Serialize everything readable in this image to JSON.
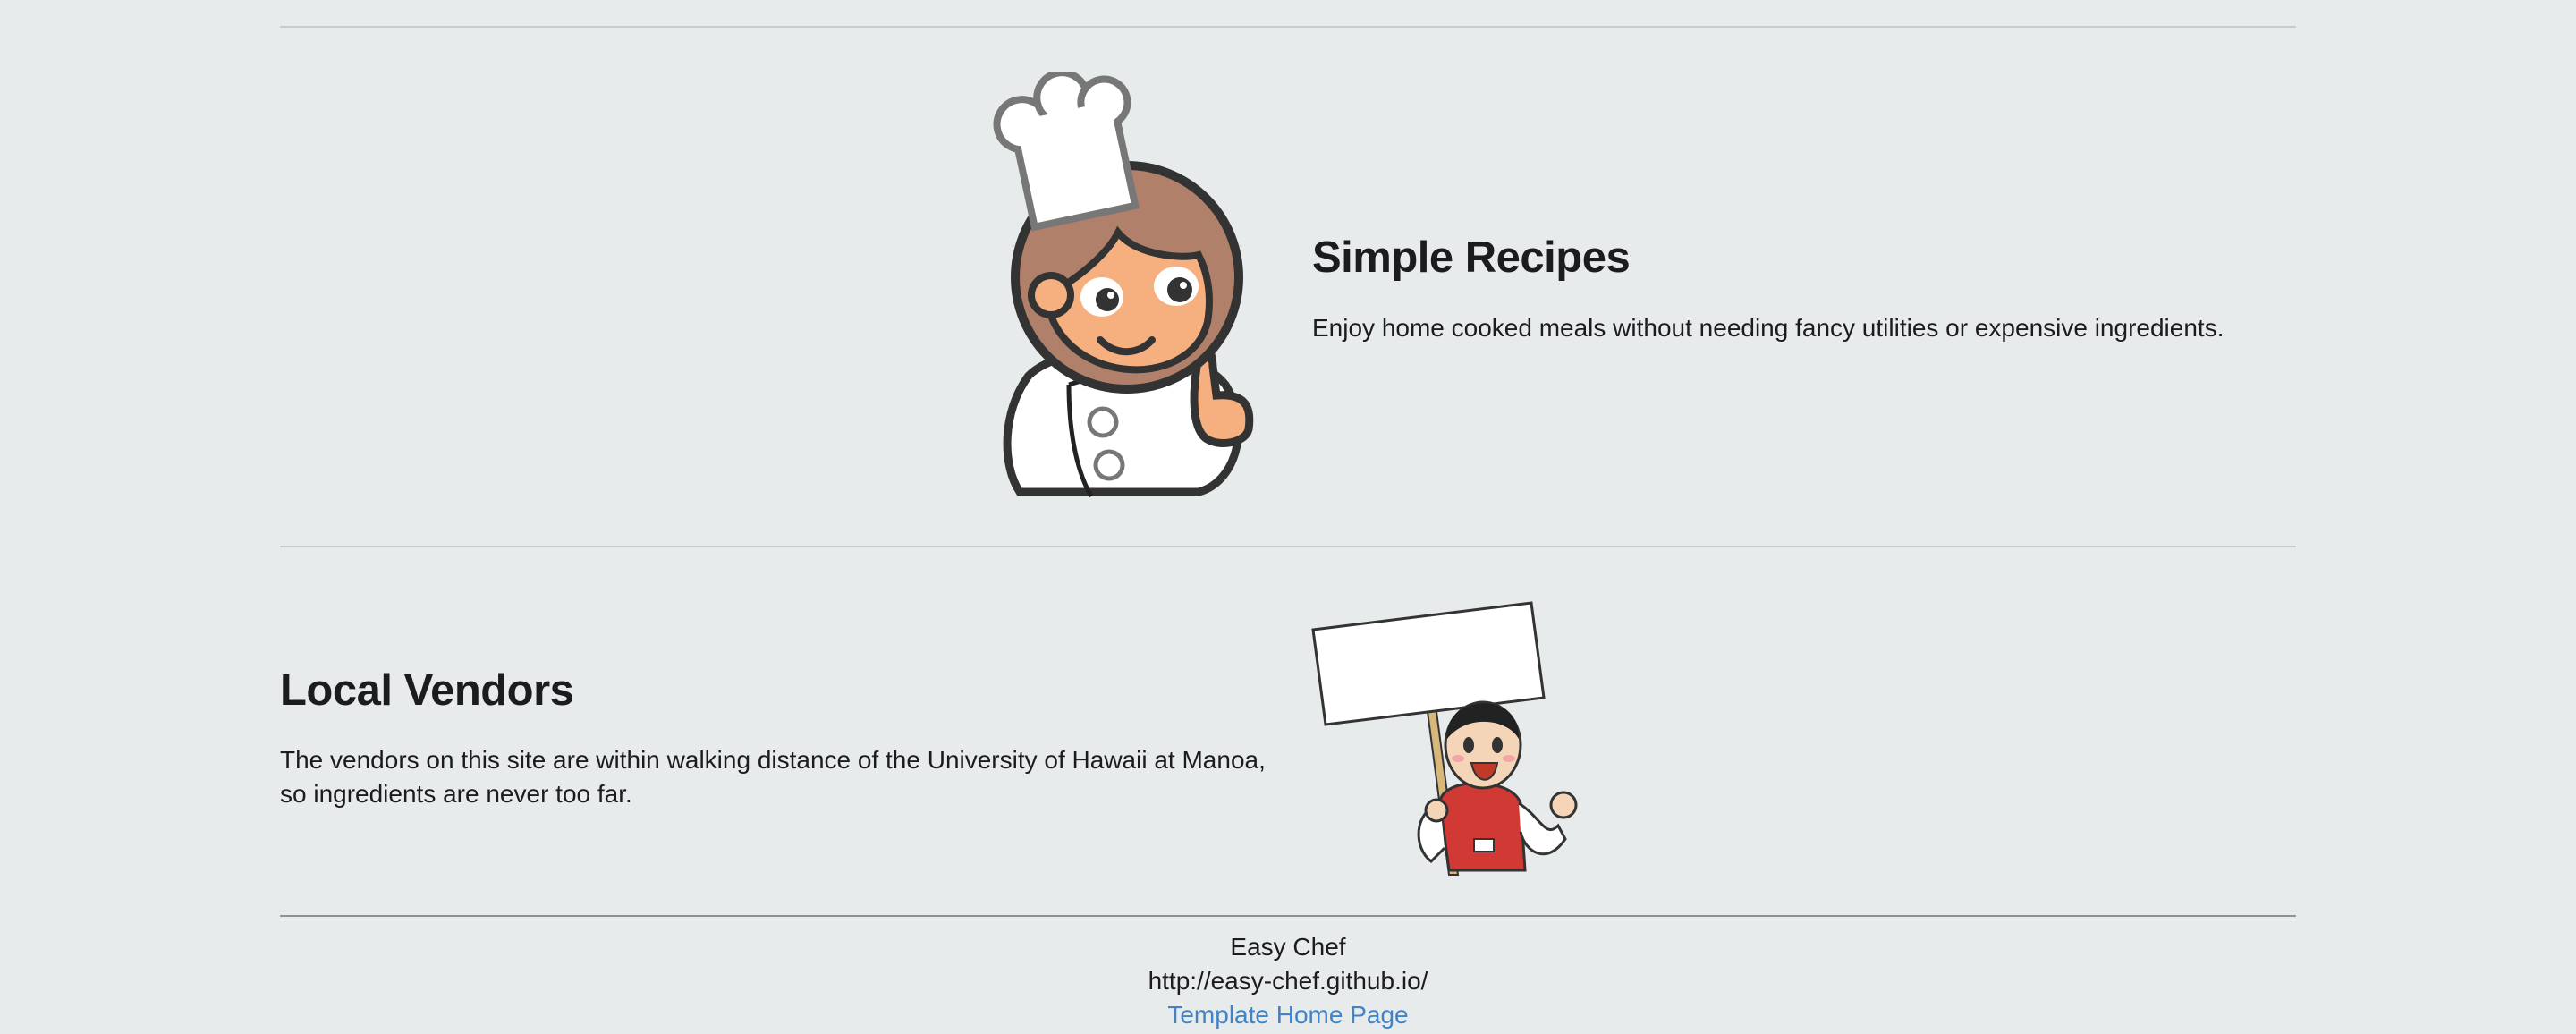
{
  "features": [
    {
      "title": "Simple Recipes",
      "description": "Enjoy home cooked meals without needing fancy utilities or expensive ingredients.",
      "image": "chef-thumbs-up-illustration"
    },
    {
      "title": "Local Vendors",
      "description": "The vendors on this site are within walking distance of the University of Hawaii at Manoa, so ingredients are never too far.",
      "image": "vendor-holding-sign-illustration"
    }
  ],
  "footer": {
    "site_name": "Easy Chef",
    "site_url": "http://easy-chef.github.io/",
    "template_link": "Template Home Page"
  },
  "colors": {
    "background": "#e8ebec",
    "link": "#4183c4",
    "text": "#1b1c1d"
  }
}
